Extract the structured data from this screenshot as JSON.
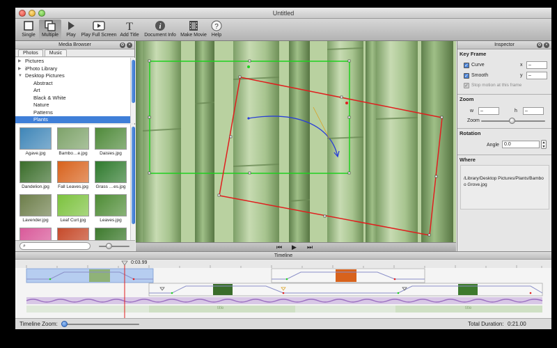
{
  "window": {
    "title": "Untitled"
  },
  "toolbar": {
    "items": [
      {
        "label": "Single",
        "icon": "single-icon"
      },
      {
        "label": "Multiple",
        "icon": "multiple-icon"
      },
      {
        "label": "Play",
        "icon": "play-icon"
      },
      {
        "label": "Play Full Screen",
        "icon": "play-fullscreen-icon"
      },
      {
        "label": "Add Title",
        "icon": "add-title-icon"
      },
      {
        "label": "Document Info",
        "icon": "info-icon"
      },
      {
        "label": "Make Movie",
        "icon": "film-icon"
      },
      {
        "label": "Help",
        "icon": "help-icon"
      }
    ]
  },
  "media_browser": {
    "title": "Media Browser",
    "tabs": [
      "Photos",
      "Music"
    ],
    "tree": [
      {
        "label": "Pictures",
        "level": 1
      },
      {
        "label": "iPhoto Library",
        "level": 1
      },
      {
        "label": "Desktop Pictures",
        "level": 1
      },
      {
        "label": "Abstract",
        "level": 2
      },
      {
        "label": "Art",
        "level": 2
      },
      {
        "label": "Black & White",
        "level": 2
      },
      {
        "label": "Nature",
        "level": 2
      },
      {
        "label": "Patterns",
        "level": 2
      },
      {
        "label": "Plants",
        "level": 2,
        "selected": true
      }
    ],
    "thumbnails": [
      {
        "name": "Agave.jpg",
        "color": "#3f86b8"
      },
      {
        "name": "Bambo…e.jpg",
        "color": "#7ea36a"
      },
      {
        "name": "Daisies.jpg",
        "color": "#4f8a3a"
      },
      {
        "name": "Dandelion.jpg",
        "color": "#3a6d2a"
      },
      {
        "name": "Fall Leaves.jpg",
        "color": "#d8621c"
      },
      {
        "name": "Grass …es.jpg",
        "color": "#2f7a2d"
      },
      {
        "name": "Lavender.jpg",
        "color": "#6d7e4a"
      },
      {
        "name": "Leaf Curl.jpg",
        "color": "#7cc23e"
      },
      {
        "name": "Leaves.jpg",
        "color": "#4e8c35"
      },
      {
        "name": "",
        "color": "#d95a9a"
      },
      {
        "name": "",
        "color": "#c64a2a"
      },
      {
        "name": "",
        "color": "#3d7a2d"
      }
    ],
    "search_placeholder": ""
  },
  "inspector": {
    "title": "Inspector",
    "keyframe": {
      "heading": "Key Frame",
      "curve_label": "Curve",
      "smooth_label": "Smooth",
      "stop_label": "Stop motion at this frame",
      "x_label": "x",
      "y_label": "y",
      "x_value": "–",
      "y_value": "–"
    },
    "zoom": {
      "heading": "Zoom",
      "w_label": "w",
      "h_label": "h",
      "w_value": "–",
      "h_value": "–",
      "zoom_label": "Zoom"
    },
    "rotation": {
      "heading": "Rotation",
      "angle_label": "Angle",
      "angle_value": "0.0"
    },
    "where": {
      "heading": "Where",
      "path": "/Library/Desktop Pictures/Plants/Bamboo Grove.jpg"
    }
  },
  "timeline": {
    "title": "Timeline",
    "playhead_time": "0:03.99",
    "zoom_label": "Timeline Zoom:",
    "total_duration_label": "Total Duration:",
    "total_duration": "0:21.00",
    "title_track_labels": [
      "title",
      "title"
    ]
  },
  "colors": {
    "start_frame": "#1fd11f",
    "end_frame": "#e01e1e",
    "motion_path": "#2a3fd6",
    "selection": "#3f7fd8"
  }
}
